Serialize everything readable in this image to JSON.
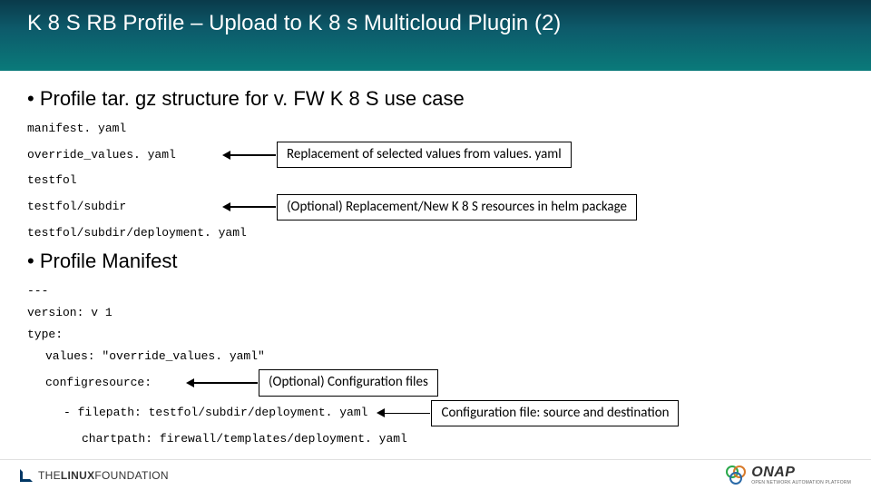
{
  "header": {
    "title": "K 8 S RB Profile – Upload to K 8 s Multicloud Plugin (2)"
  },
  "bullet1": "• Profile tar. gz structure for v. FW K 8 S use case",
  "files": {
    "manifest": "manifest. yaml",
    "override": "override_values. yaml",
    "testfol": "testfol",
    "subdir": "testfol/subdir",
    "deployment": "testfol/subdir/deployment. yaml"
  },
  "annot": {
    "replacement": "Replacement of selected values from values. yaml",
    "optional_k8s": "(Optional) Replacement/New K 8 S resources in helm package",
    "config_files": "(Optional) Configuration files",
    "config_src": "Configuration file: source and destination"
  },
  "bullet2": "• Profile Manifest",
  "yaml": {
    "dash": "---",
    "version": "version: v 1",
    "type": "type:",
    "values": "values: \"override_values. yaml\"",
    "configresource": "configresource:",
    "filepath": "- filepath: testfol/subdir/deployment. yaml",
    "chartpath": "chartpath: firewall/templates/deployment. yaml"
  },
  "footer": {
    "lf_the": "THE",
    "lf_linux": "LINUX",
    "lf_found": "FOUNDATION",
    "onap": "ONAP",
    "onap_sub": "OPEN NETWORK AUTOMATION PLATFORM"
  }
}
